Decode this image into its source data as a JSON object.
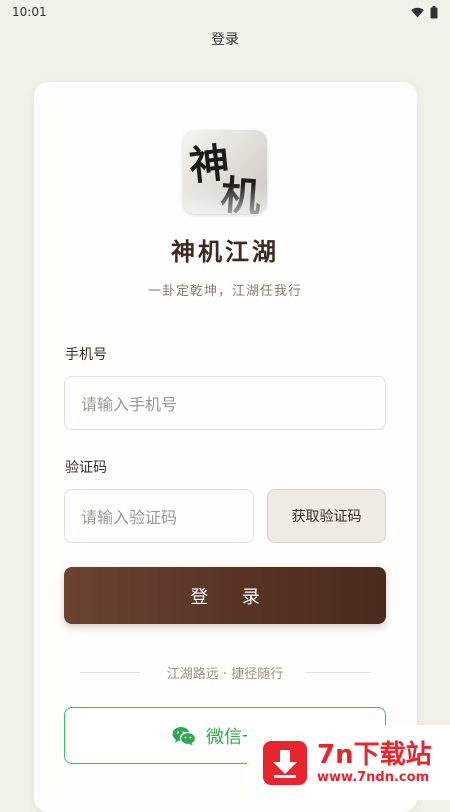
{
  "status_bar": {
    "time": "10:01",
    "icons": [
      "wifi-icon",
      "battery-icon"
    ]
  },
  "header": {
    "title": "登录"
  },
  "brand": {
    "logo_chars": [
      "神",
      "机"
    ],
    "app_name": "神机江湖",
    "slogan": "一卦定乾坤，江湖任我行"
  },
  "form": {
    "phone_label": "手机号",
    "phone_placeholder": "请输入手机号",
    "code_label": "验证码",
    "code_placeholder": "请输入验证码",
    "get_code_label": "获取验证码",
    "login_label": "登 录"
  },
  "divider": {
    "text": "江湖路远 · 捷径随行"
  },
  "wechat": {
    "label": "微信一键",
    "icon": "wechat-icon"
  },
  "watermark": {
    "title": "7n下载站",
    "url": "www.7ndn.com",
    "icon": "download-arrow-icon"
  },
  "colors": {
    "background": "#f3f0ea",
    "brand_brown": "#5a3526",
    "wechat_green": "#2daa54",
    "watermark_red": "#e8252c"
  }
}
